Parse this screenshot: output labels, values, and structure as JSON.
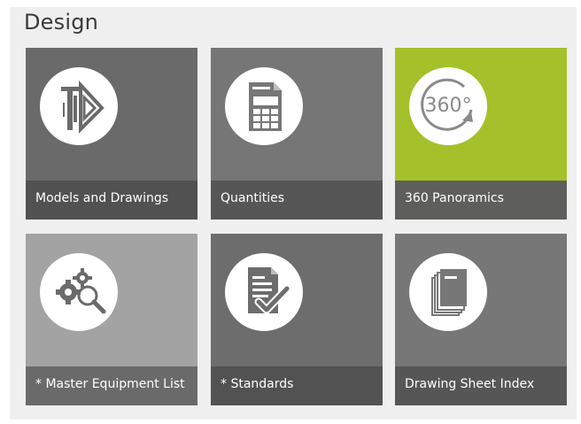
{
  "section": {
    "title": "Design"
  },
  "tiles": [
    {
      "label": "Models and Drawings",
      "icon": "models-drawings-icon",
      "color": "#6a6a6a"
    },
    {
      "label": "Quantities",
      "icon": "calculator-document-icon",
      "color": "#767676"
    },
    {
      "label": "360 Panoramics",
      "icon": "panorama-360-icon",
      "icon_text": "360°",
      "color": "#a4c12b"
    },
    {
      "label": "* Master Equipment List",
      "icon": "gears-search-icon",
      "color": "#a3a3a3"
    },
    {
      "label": "* Standards",
      "icon": "document-check-icon",
      "color": "#6d6d6d"
    },
    {
      "label": "Drawing Sheet Index",
      "icon": "sheet-stack-icon",
      "color": "#777777"
    }
  ]
}
